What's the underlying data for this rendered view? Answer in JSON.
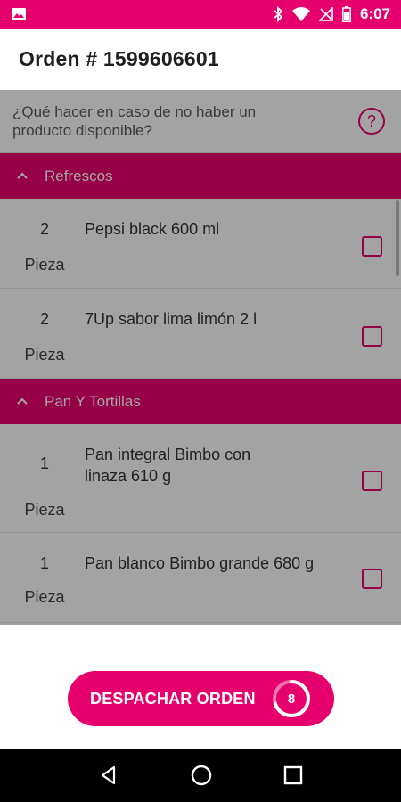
{
  "status_bar": {
    "time": "6:07",
    "icons": [
      "image-icon",
      "bluetooth-icon",
      "wifi-icon",
      "no-signal-icon",
      "battery-icon"
    ]
  },
  "header": {
    "title": "Orden # 1599606601"
  },
  "question": {
    "text": "¿Qué hacer en caso de no haber un producto disponible?",
    "help_icon": "?"
  },
  "categories": [
    {
      "title": "Refrescos",
      "items": [
        {
          "qty": "2",
          "unit": "Pieza",
          "name": "Pepsi black 600 ml",
          "checked": false
        },
        {
          "qty": "2",
          "unit": "Pieza",
          "name": "7Up sabor lima limón 2 l",
          "checked": false
        }
      ]
    },
    {
      "title": "Pan Y Tortillas",
      "items": [
        {
          "qty": "1",
          "unit": "Pieza",
          "name": "Pan integral Bimbo con linaza 610 g",
          "checked": false
        },
        {
          "qty": "1",
          "unit": "Pieza",
          "name": "Pan blanco Bimbo grande 680 g",
          "checked": false
        }
      ]
    }
  ],
  "dispatch": {
    "label": "DESPACHAR ORDEN",
    "count": "8",
    "progress": 0.7
  },
  "colors": {
    "accent": "#e6006e",
    "status_bar": "#e6006e",
    "nav_bar": "#000000"
  }
}
